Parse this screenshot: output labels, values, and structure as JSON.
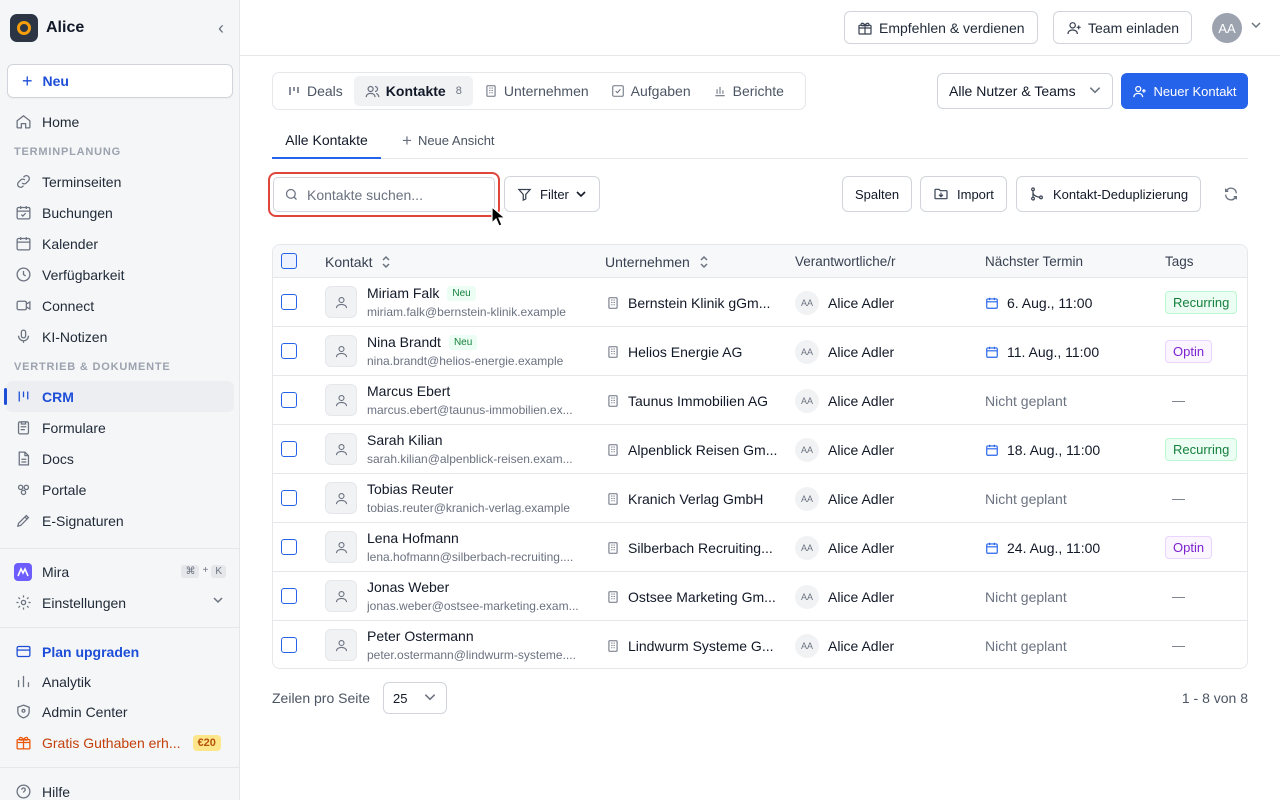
{
  "workspace": {
    "name": "Alice"
  },
  "sidebar": {
    "new_label": "Neu",
    "items_top": [
      {
        "label": "Home",
        "icon": "home-icon"
      }
    ],
    "section_termin": "TERMINPLANUNG",
    "items_termin": [
      {
        "label": "Terminseiten",
        "icon": "link-icon"
      },
      {
        "label": "Buchungen",
        "icon": "calendar-check-icon"
      },
      {
        "label": "Kalender",
        "icon": "calendar-icon"
      },
      {
        "label": "Verfügbarkeit",
        "icon": "clock-icon"
      },
      {
        "label": "Connect",
        "icon": "video-icon"
      },
      {
        "label": "KI-Notizen",
        "icon": "microphone-icon"
      }
    ],
    "section_vertrieb": "VERTRIEB & DOKUMENTE",
    "items_vertrieb": [
      {
        "label": "CRM",
        "icon": "crm-icon",
        "active": true
      },
      {
        "label": "Formulare",
        "icon": "clipboard-icon"
      },
      {
        "label": "Docs",
        "icon": "document-icon"
      },
      {
        "label": "Portale",
        "icon": "portal-icon"
      },
      {
        "label": "E-Signaturen",
        "icon": "pen-icon"
      }
    ],
    "mira": {
      "label": "Mira",
      "shortcut_key1": "⌘",
      "shortcut_plus": "+",
      "shortcut_key2": "K"
    },
    "settings_label": "Einstellungen",
    "plan_upgrade_label": "Plan upgraden",
    "analytics_label": "Analytik",
    "admin_label": "Admin Center",
    "credit_label": "Gratis Guthaben erh...",
    "credit_badge": "€20",
    "help_label": "Hilfe"
  },
  "topbar": {
    "refer_label": "Empfehlen & verdienen",
    "invite_label": "Team einladen",
    "avatar_initials": "AA"
  },
  "tabs": [
    {
      "label": "Deals",
      "icon": "deals-icon"
    },
    {
      "label": "Kontakte",
      "icon": "users-icon",
      "count": "8",
      "active": true
    },
    {
      "label": "Unternehmen",
      "icon": "building-icon"
    },
    {
      "label": "Aufgaben",
      "icon": "check-square-icon"
    },
    {
      "label": "Berichte",
      "icon": "bar-chart-icon"
    }
  ],
  "user_filter": "Alle Nutzer & Teams",
  "new_contact_label": "Neuer Kontakt",
  "views": {
    "active": "Alle Kontakte",
    "add": "Neue Ansicht"
  },
  "search": {
    "placeholder": "Kontakte suchen...",
    "value": ""
  },
  "toolbar": {
    "filter_label": "Filter",
    "columns_label": "Spalten",
    "import_label": "Import",
    "dedupe_label": "Kontakt-Deduplizierung"
  },
  "table": {
    "headers": {
      "contact": "Kontakt",
      "company": "Unternehmen",
      "owner": "Verantwortliche/r",
      "next": "Nächster Termin",
      "tags": "Tags"
    },
    "rows": [
      {
        "name": "Miriam Falk",
        "badge": "Neu",
        "email": "miriam.falk@bernstein-klinik.example",
        "company": "Bernstein Klinik gGm...",
        "owner_initials": "AA",
        "owner": "Alice Adler",
        "next": "6. Aug., 11:00",
        "scheduled": true,
        "tag": "Recurring",
        "tag_type": "recurring"
      },
      {
        "name": "Nina Brandt",
        "badge": "Neu",
        "email": "nina.brandt@helios-energie.example",
        "company": "Helios Energie AG",
        "owner_initials": "AA",
        "owner": "Alice Adler",
        "next": "11. Aug., 11:00",
        "scheduled": true,
        "tag": "Optin",
        "tag_type": "optin"
      },
      {
        "name": "Marcus Ebert",
        "badge": "",
        "email": "marcus.ebert@taunus-immobilien.ex...",
        "company": "Taunus Immobilien AG",
        "owner_initials": "AA",
        "owner": "Alice Adler",
        "next": "Nicht geplant",
        "scheduled": false,
        "tag": "—",
        "tag_type": "dash"
      },
      {
        "name": "Sarah Kilian",
        "badge": "",
        "email": "sarah.kilian@alpenblick-reisen.exam...",
        "company": "Alpenblick Reisen Gm...",
        "owner_initials": "AA",
        "owner": "Alice Adler",
        "next": "18. Aug., 11:00",
        "scheduled": true,
        "tag": "Recurring",
        "tag_type": "recurring"
      },
      {
        "name": "Tobias Reuter",
        "badge": "",
        "email": "tobias.reuter@kranich-verlag.example",
        "company": "Kranich Verlag GmbH",
        "owner_initials": "AA",
        "owner": "Alice Adler",
        "next": "Nicht geplant",
        "scheduled": false,
        "tag": "—",
        "tag_type": "dash"
      },
      {
        "name": "Lena Hofmann",
        "badge": "",
        "email": "lena.hofmann@silberbach-recruiting....",
        "company": "Silberbach Recruiting...",
        "owner_initials": "AA",
        "owner": "Alice Adler",
        "next": "24. Aug., 11:00",
        "scheduled": true,
        "tag": "Optin",
        "tag_type": "optin"
      },
      {
        "name": "Jonas Weber",
        "badge": "",
        "email": "jonas.weber@ostsee-marketing.exam...",
        "company": "Ostsee Marketing Gm...",
        "owner_initials": "AA",
        "owner": "Alice Adler",
        "next": "Nicht geplant",
        "scheduled": false,
        "tag": "—",
        "tag_type": "dash"
      },
      {
        "name": "Peter Ostermann",
        "badge": "",
        "email": "peter.ostermann@lindwurm-systeme....",
        "company": "Lindwurm Systeme G...",
        "owner_initials": "AA",
        "owner": "Alice Adler",
        "next": "Nicht geplant",
        "scheduled": false,
        "tag": "—",
        "tag_type": "dash"
      }
    ]
  },
  "footer": {
    "rows_per_page_label": "Zeilen pro Seite",
    "rows_per_page_value": "25",
    "pagination": "1 - 8 von 8"
  },
  "colors": {
    "accent": "#2563eb",
    "highlight": "#e0453a",
    "credit": "#c2410c"
  }
}
